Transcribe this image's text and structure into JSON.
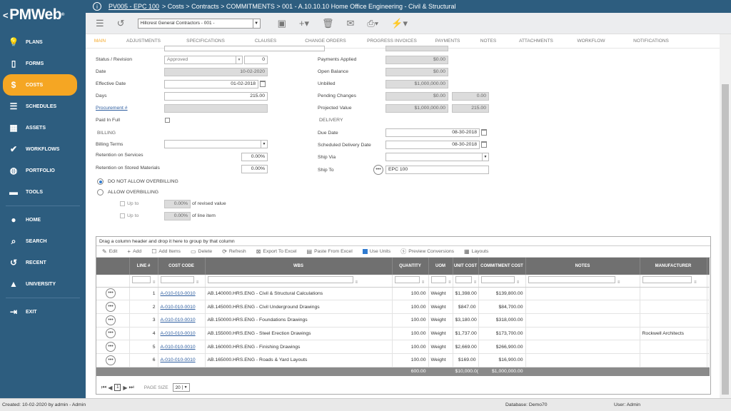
{
  "app": {
    "logo": "PMWeb",
    "logo_mark": "®"
  },
  "sidebar": {
    "items": [
      {
        "label": "PLANS",
        "icon": "bulb-icon"
      },
      {
        "label": "FORMS",
        "icon": "form-icon"
      },
      {
        "label": "COSTS",
        "icon": "dollar-icon",
        "active": true
      },
      {
        "label": "SCHEDULES",
        "icon": "schedule-icon"
      },
      {
        "label": "ASSETS",
        "icon": "building-icon"
      },
      {
        "label": "WORKFLOWS",
        "icon": "check-icon"
      },
      {
        "label": "PORTFOLIO",
        "icon": "globe-icon"
      },
      {
        "label": "TOOLS",
        "icon": "toolbox-icon"
      }
    ],
    "items2": [
      {
        "label": "HOME",
        "icon": "user-icon"
      },
      {
        "label": "SEARCH",
        "icon": "search-icon"
      },
      {
        "label": "RECENT",
        "icon": "history-icon"
      },
      {
        "label": "UNIVERSITY",
        "icon": "graduation-icon"
      }
    ],
    "items3": [
      {
        "label": "EXIT",
        "icon": "exit-icon"
      }
    ]
  },
  "breadcrumb": {
    "project": "PV005 - EPC 100",
    "rest": "> Costs > Contracts > COMMITMENTS > 001 - A.10.10.10 Home Office Engineering - Civil & Structural"
  },
  "toolbar": {
    "contract": "Hillcrest General Contractors - 001 -"
  },
  "tabs": [
    "MAIN",
    "ADJUSTMENTS",
    "SPECIFICATIONS",
    "CLAUSES",
    "CHANGE ORDERS",
    "PROGRESS INVOICES",
    "PAYMENTS",
    "NOTES",
    "ATTACHMENTS",
    "WORKFLOW",
    "NOTIFICATIONS"
  ],
  "form": {
    "status_label": "Status / Revision",
    "status_value": "Approved",
    "revision": "0",
    "date_label": "Date",
    "date_value": "10-02-2020",
    "effective_label": "Effective Date",
    "effective_value": "01-02-2018",
    "days_label": "Days",
    "days_value": "215.00",
    "procurement_label": "Procurement #",
    "paid_label": "Paid In Full",
    "billing_header": "BILLING",
    "billing_terms_label": "Billing Terms",
    "ret_services_label": "Retention on Services",
    "ret_services_value": "0.00%",
    "ret_materials_label": "Retention on Stored Materials",
    "ret_materials_value": "0.00%",
    "no_overbill": "DO NOT ALLOW OVERBILLING",
    "allow_overbill": "ALLOW OVERBILLING",
    "upto1": "Up to",
    "upto1_value": "0.00%",
    "upto1_suffix": "of revised value",
    "upto2": "Up to",
    "upto2_value": "0.00%",
    "upto2_suffix": "of line item",
    "payments_label": "Payments Applied",
    "payments_value": "$0.00",
    "open_label": "Open Balance",
    "open_value": "$0.00",
    "unbilled_label": "Unbilled",
    "unbilled_value": "$1,000,000.00",
    "pending_label": "Pending Changes",
    "pending_value": "$0.00",
    "pending_days": "0.00",
    "projected_label": "Projected Value",
    "projected_value": "$1,000,000.00",
    "projected_days": "215.00",
    "delivery_header": "DELIVERY",
    "due_label": "Due Date",
    "due_value": "08-30-2018",
    "sched_label": "Scheduled Delivery Date",
    "sched_value": "08-30-2018",
    "shipvia_label": "Ship Via",
    "shipto_label": "Ship To",
    "shipto_value": "EPC 100"
  },
  "grid": {
    "group_hint": "Drag a column header and drop it here to group by that column",
    "toolbar": [
      "Edit",
      "Add",
      "Add Items",
      "Delete",
      "Refresh",
      "Export To Excel",
      "Paste From Excel",
      "Use Units",
      "Preview Conversions",
      "Layouts"
    ],
    "columns": [
      "LINE #",
      "COST CODE",
      "WBS",
      "QUANTITY",
      "UOM",
      "UNIT COST",
      "COMMITMENT COST",
      "NOTES",
      "MANUFACTURER"
    ],
    "rows": [
      {
        "line": "1",
        "code": "A-010-010-0010",
        "wbs": "AB.140000.HRS.ENG - Civil & Structural Calculations",
        "qty": "100.00",
        "uom": "Weight",
        "unit": "$1,398.00",
        "cost": "$139,800.00",
        "notes": "",
        "mfr": ""
      },
      {
        "line": "2",
        "code": "A-010-010-0010",
        "wbs": "AB.145000.HRS.ENG - Civil Underground Drawings",
        "qty": "100.00",
        "uom": "Weight",
        "unit": "$847.00",
        "cost": "$84,700.00",
        "notes": "",
        "mfr": ""
      },
      {
        "line": "3",
        "code": "A-010-010-0010",
        "wbs": "AB.150000.HRS.ENG - Foundations Drawings",
        "qty": "100.00",
        "uom": "Weight",
        "unit": "$3,180.00",
        "cost": "$318,000.00",
        "notes": "",
        "mfr": ""
      },
      {
        "line": "4",
        "code": "A-010-010-0010",
        "wbs": "AB.155000.HRS.ENG - Steel Erection Drawings",
        "qty": "100.00",
        "uom": "Weight",
        "unit": "$1,737.00",
        "cost": "$173,700.00",
        "notes": "",
        "mfr": "Rockwell Architects"
      },
      {
        "line": "5",
        "code": "A-010-010-0010",
        "wbs": "AB.160000.HRS.ENG - Finishing Drawings",
        "qty": "100.00",
        "uom": "Weight",
        "unit": "$2,669.00",
        "cost": "$266,900.00",
        "notes": "",
        "mfr": ""
      },
      {
        "line": "6",
        "code": "A-010-010-0010",
        "wbs": "AB.165000.HRS.ENG - Roads & Yard Layouts",
        "qty": "100.00",
        "uom": "Weight",
        "unit": "$169.00",
        "cost": "$16,900.00",
        "notes": "",
        "mfr": ""
      }
    ],
    "totals": {
      "qty": "600.00",
      "unit": "$10,000.0(",
      "cost": "$1,000,000.00"
    },
    "pager": {
      "page": "1",
      "size_label": "PAGE SIZE",
      "size": "20"
    }
  },
  "status": {
    "created": "Created:  10-02-2020 by admin - Admin",
    "database": "Database:   Demo70",
    "user": "User:   Admin"
  }
}
